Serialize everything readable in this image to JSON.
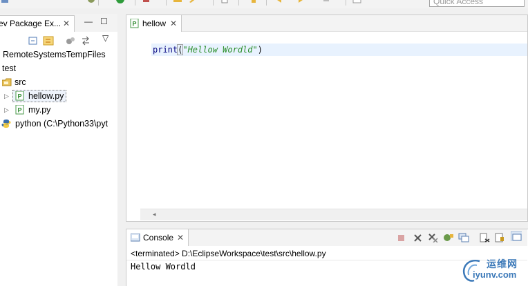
{
  "toolbar": {
    "quick_access_placeholder": "Quick Access"
  },
  "explorer": {
    "tab_title": "ev Package Ex...",
    "close_glyph": "✕",
    "minimize_glyph": "—",
    "maximize_glyph": "☐",
    "menu_glyph": "▽",
    "tree": [
      {
        "label": "RemoteSystemsTempFiles"
      },
      {
        "label": "test"
      },
      {
        "label": "src"
      },
      {
        "label": "hellow.py"
      },
      {
        "label": "my.py"
      },
      {
        "label": "python   (C:\\Python33\\pyt"
      }
    ]
  },
  "editor": {
    "tab_title": "hellow",
    "close_glyph": "✕",
    "code": {
      "fn": "print",
      "open": "(",
      "string": "\"Hellow Wordld\"",
      "close": ")"
    }
  },
  "console": {
    "tab_title": "Console",
    "close_glyph": "✕",
    "description": "<terminated> D:\\EclipseWorkspace\\test\\src\\hellow.py",
    "output": "Hellow Wordld"
  },
  "watermark": {
    "cn": "运维网",
    "en": "iyunv.com"
  },
  "colors": {
    "keyword": "#00007f",
    "string": "#2a8e2a",
    "current_line": "#e8f2fe",
    "watermark": "#3a78b8"
  }
}
